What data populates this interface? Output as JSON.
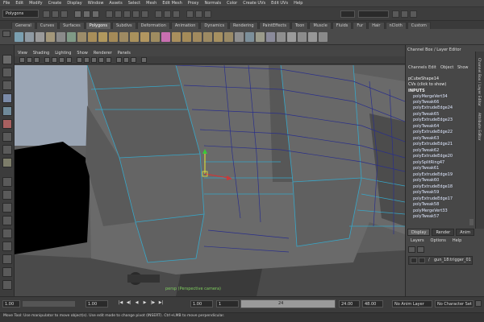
{
  "menubar": {
    "items": [
      "File",
      "Edit",
      "Modify",
      "Create",
      "Display",
      "Window",
      "Assets",
      "Select",
      "Mesh",
      "Edit Mesh",
      "Proxy",
      "Normals",
      "Color",
      "Create UVs",
      "Edit UVs",
      "Help"
    ]
  },
  "status_line": {
    "mode": "Polygons"
  },
  "shelf": {
    "tabs": [
      "General",
      "Curves",
      "Surfaces",
      "Polygons",
      "Subdivs",
      "Deformation",
      "Animation",
      "Dynamics",
      "Rendering",
      "PaintEffects",
      "Toon",
      "Muscle",
      "Fluids",
      "Fur",
      "Hair",
      "nCloth",
      "Custom"
    ],
    "active_tab": "Polygons"
  },
  "panel": {
    "menu": [
      "View",
      "Shading",
      "Lighting",
      "Show",
      "Renderer",
      "Panels"
    ],
    "camera_label": "persp (Perspective camera)"
  },
  "channel_box": {
    "title": "Channel Box / Layer Editor",
    "menu": [
      "Channels",
      "Edit",
      "Object",
      "Show"
    ],
    "shape_node": "pCubeShape14",
    "cvs_label": "CVs (click to show)",
    "inputs_header": "INPUTS",
    "inputs": [
      "polyMergeVert34",
      "polyTweak66",
      "polyExtrudeEdge24",
      "polyTweak65",
      "polyExtrudeEdge23",
      "polyTweak64",
      "polyExtrudeEdge22",
      "polyTweak63",
      "polyExtrudeEdge21",
      "polyTweak62",
      "polyExtrudeEdge20",
      "polySplitRing47",
      "polyTweak61",
      "polyExtrudeEdge19",
      "polyTweak60",
      "polyExtrudeEdge18",
      "polyTweak59",
      "polyExtrudeEdge17",
      "polyTweak58",
      "polyMergeVert33",
      "polyTweak57"
    ],
    "side_tabs": [
      "Channel Box / Layer Editor",
      "Attribute Editor"
    ]
  },
  "layer_editor": {
    "tabs": [
      "Display",
      "Render",
      "Anim"
    ],
    "active_tab": "Display",
    "menu": [
      "Layers",
      "Options",
      "Help"
    ],
    "layer_name": "gun_18:trigger_01"
  },
  "time_slider": {
    "start_time": "1.00",
    "playback_start": "1.00",
    "current_frame": "1",
    "range_end": "24",
    "playback_end": "24.00",
    "end_time": "48.00",
    "anim_layer": "No Anim Layer",
    "character_set": "No Character Set",
    "playback_buttons": [
      "|◀",
      "◀|",
      "◀",
      "▶",
      "|▶",
      "▶|"
    ]
  },
  "help_line": {
    "text": "Move Tool: Use manipulator to move object(s). Use edit mode to change pivot (INSERT). Ctrl+LMB to move perpendicular."
  }
}
